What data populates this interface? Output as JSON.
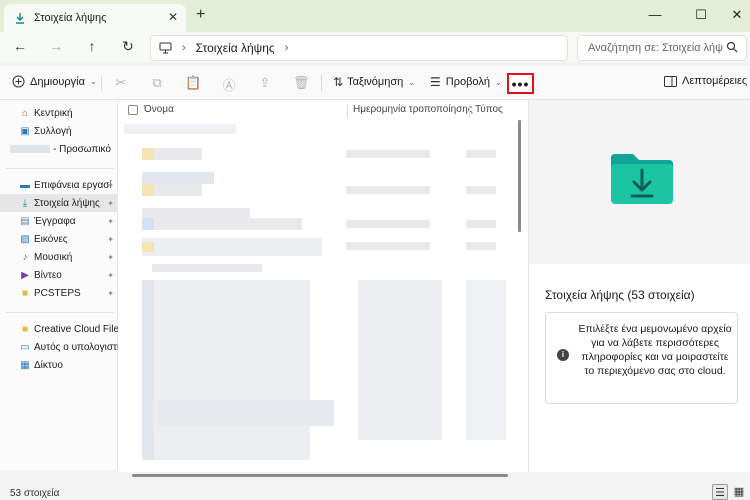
{
  "window": {
    "tab_title": "Στοιχεία λήψης",
    "tab_close": "✕",
    "new_tab": "+",
    "minimize": "—",
    "maximize": "☐",
    "close": "✕"
  },
  "nav": {
    "back": "←",
    "forward": "→",
    "up": "↑",
    "refresh": "↻"
  },
  "address": {
    "sep": "›",
    "crumb": "Στοιχεία λήψης",
    "trail": "›"
  },
  "search": {
    "placeholder": "Αναζήτηση σε: Στοιχεία λήψ"
  },
  "toolbar": {
    "new_label": "Δημιουργία",
    "sort_label": "Ταξινόμηση",
    "view_label": "Προβολή",
    "more_label": "•••",
    "details_label": "Λεπτομέρειες",
    "chev": "⌄"
  },
  "sidebar": {
    "items": [
      {
        "label": "Κεντρική"
      },
      {
        "label": "Συλλογή"
      },
      {
        "label": "- Προσωπικό"
      },
      {
        "label": "Επιφάνεια εργασί"
      },
      {
        "label": "Στοιχεία λήψης"
      },
      {
        "label": "Έγγραφα"
      },
      {
        "label": "Εικόνες"
      },
      {
        "label": "Μουσική"
      },
      {
        "label": "Βίντεο"
      },
      {
        "label": "PCSTEPS"
      },
      {
        "label": "Creative Cloud Files F"
      },
      {
        "label": "Αυτός ο υπολογιστή"
      },
      {
        "label": "Δίκτυο"
      }
    ],
    "pin": "📌"
  },
  "filelist": {
    "columns": {
      "name": "Όνομα",
      "date": "Ημερομηνία τροποποίησης",
      "type": "Τύπος"
    }
  },
  "details": {
    "title": "Στοιχεία λήψης (53 στοιχεία)",
    "info_icon": "i",
    "info_text": "Επιλέξτε ένα μεμονωμένο αρχείο για να λάβετε περισσότερες πληροφορίες και να μοιραστείτε το περιεχόμενο σας στο cloud."
  },
  "status": {
    "count": "53 στοιχεία",
    "details_view": "☰",
    "tiles_view": "▦"
  },
  "colors": {
    "accent": "#0f8c84",
    "highlight_border": "#e0101a",
    "titlebar": "#e4eed6"
  }
}
